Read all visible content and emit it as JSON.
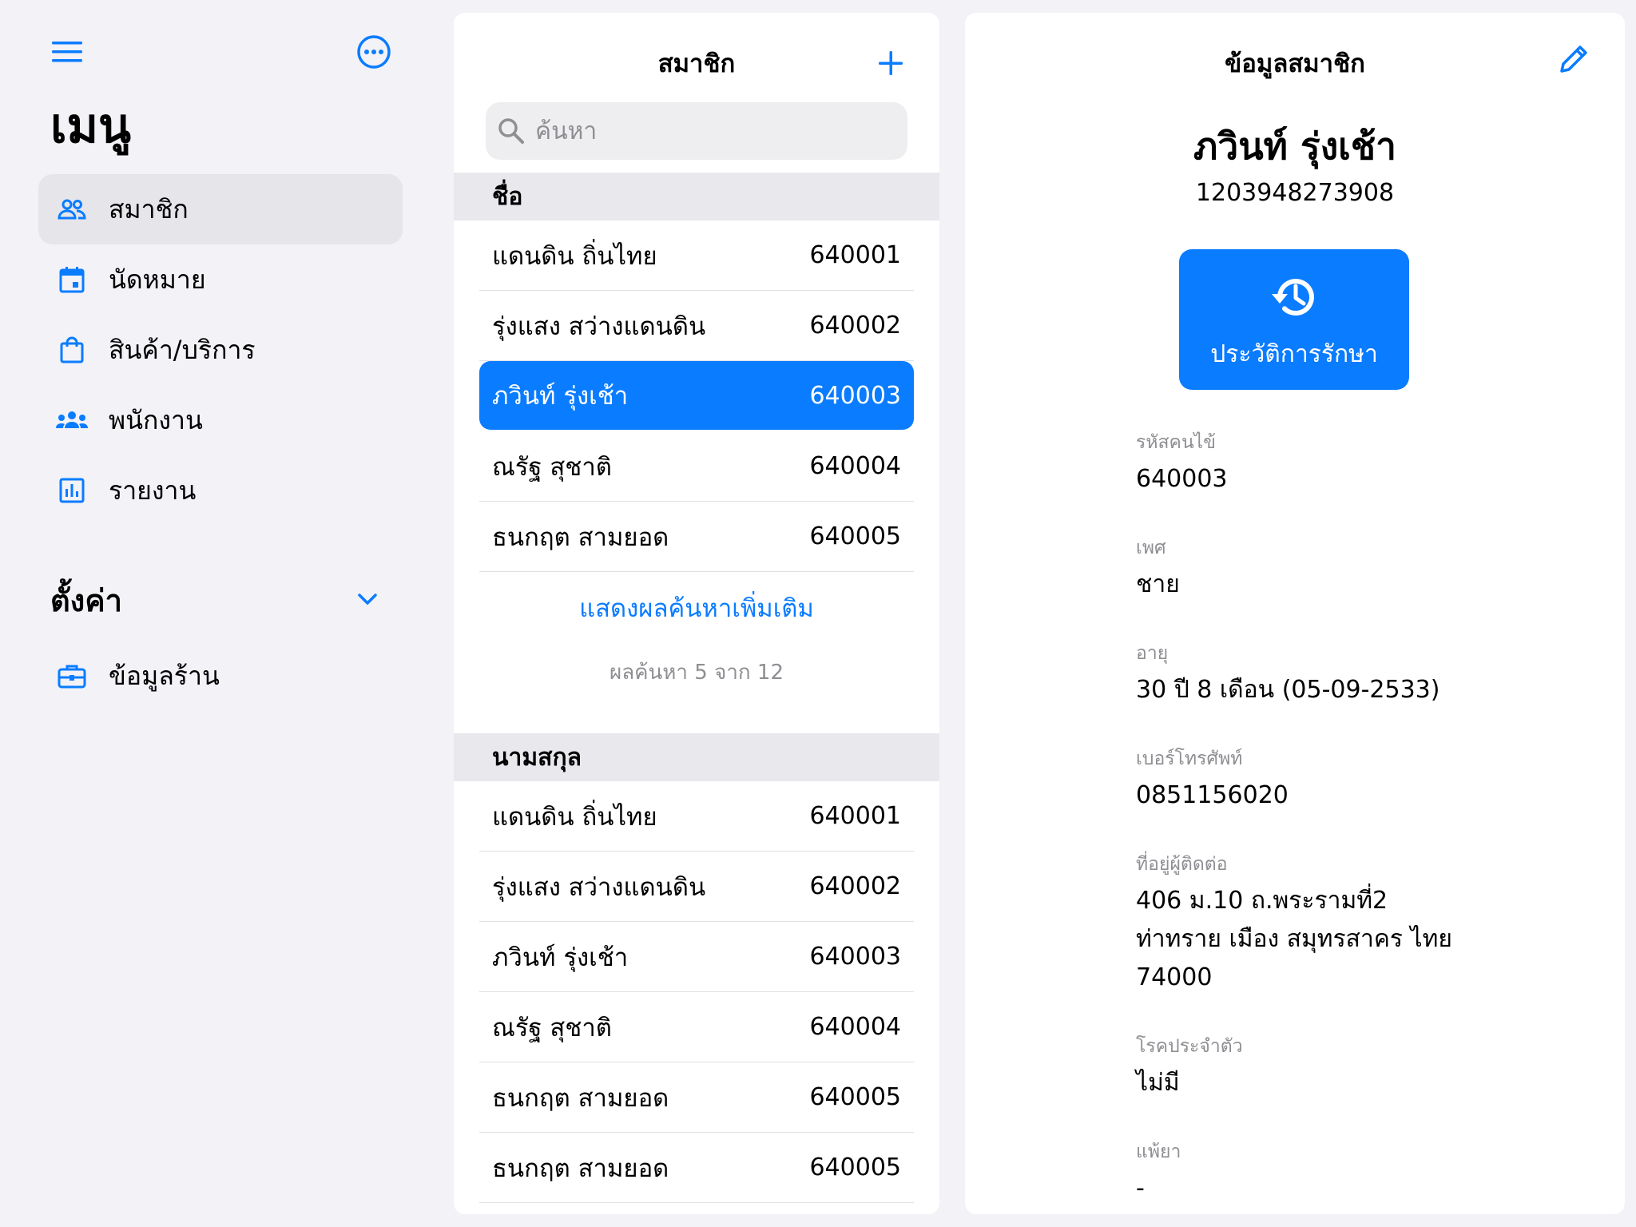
{
  "sidebar": {
    "title": "เมนู",
    "items": [
      {
        "label": "สมาชิก",
        "icon": "people-icon"
      },
      {
        "label": "นัดหมาย",
        "icon": "calendar-icon"
      },
      {
        "label": "สินค้า/บริการ",
        "icon": "shopping-bag-icon"
      },
      {
        "label": "พนักงาน",
        "icon": "groups-icon"
      },
      {
        "label": "รายงาน",
        "icon": "bar-chart-icon"
      }
    ],
    "settings_title": "ตั้งค่า",
    "settings_items": [
      {
        "label": "ข้อมูลร้าน",
        "icon": "briefcase-icon"
      }
    ]
  },
  "list": {
    "title": "สมาชิก",
    "search_placeholder": "ค้นหา",
    "section_name": "ชื่อ",
    "section_surname": "นามสกุล",
    "by_name": [
      {
        "name": "แดนดิน ถิ่นไทย",
        "code": "640001"
      },
      {
        "name": "รุ่งแสง สว่างแดนดิน",
        "code": "640002"
      },
      {
        "name": "ภวินท์ รุ่งเช้า",
        "code": "640003"
      },
      {
        "name": "ณรัฐ สุชาติ",
        "code": "640004"
      },
      {
        "name": "ธนกฤต สามยอด",
        "code": "640005"
      }
    ],
    "show_more": "แสดงผลค้นหาเพิ่มเติม",
    "result_count": "ผลค้นหา 5 จาก 12",
    "by_surname": [
      {
        "name": "แดนดิน ถิ่นไทย",
        "code": "640001"
      },
      {
        "name": "รุ่งแสง สว่างแดนดิน",
        "code": "640002"
      },
      {
        "name": "ภวินท์ รุ่งเช้า",
        "code": "640003"
      },
      {
        "name": "ณรัฐ สุชาติ",
        "code": "640004"
      },
      {
        "name": "ธนกฤต สามยอด",
        "code": "640005"
      },
      {
        "name": "ธนกฤต สามยอด",
        "code": "640005"
      }
    ]
  },
  "detail": {
    "title": "ข้อมูลสมาชิก",
    "name": "ภวินท์ รุ่งเช้า",
    "id_number": "1203948273908",
    "history_button": "ประวัติการรักษา",
    "fields": [
      {
        "label": "รหัสคนไข้",
        "value": "640003"
      },
      {
        "label": "เพศ",
        "value": "ชาย"
      },
      {
        "label": "อายุ",
        "value": "30 ปี 8 เดือน (05-09-2533)"
      },
      {
        "label": "เบอร์โทรศัพท์",
        "value": "0851156020"
      },
      {
        "label": "ที่อยู่ผู้ติดต่อ",
        "lines": [
          "406 ม.10 ถ.พระรามที่2",
          "ท่าทราย เมือง สมุทรสาคร ไทย",
          "74000"
        ]
      },
      {
        "label": "โรคประจำตัว",
        "value": "ไม่มี"
      },
      {
        "label": "แพ้ยา",
        "value": "-"
      }
    ]
  },
  "colors": {
    "accent": "#0a7cff",
    "background": "#f2f2f7",
    "secondary_text": "#8e8e93"
  }
}
